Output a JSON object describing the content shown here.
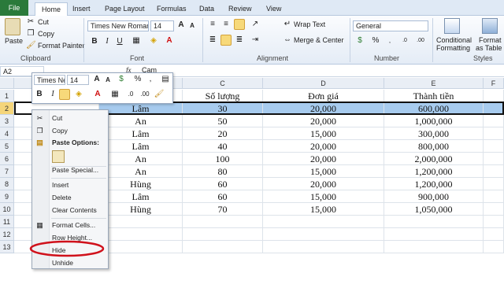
{
  "tabs": [
    "File",
    "Home",
    "Insert",
    "Page Layout",
    "Formulas",
    "Data",
    "Review",
    "View"
  ],
  "ribbon": {
    "clipboard": {
      "paste": "Paste",
      "cut": "Cut",
      "copy": "Copy",
      "format_painter": "Format Painter",
      "label": "Clipboard"
    },
    "font": {
      "name": "Times New Roman",
      "size": "14",
      "label": "Font"
    },
    "alignment": {
      "wrap": "Wrap Text",
      "merge": "Merge & Center",
      "label": "Alignment"
    },
    "number": {
      "format": "General",
      "label": "Number"
    },
    "styles": {
      "conditional_1": "Conditional",
      "conditional_2": "Formatting",
      "format_table_1": "Format",
      "format_table_2": "as Table",
      "label": "Styles"
    }
  },
  "formula_bar": {
    "name_box": "A2",
    "fx": "fx",
    "value": "Cam"
  },
  "columns": [
    "C",
    "D",
    "E",
    "F"
  ],
  "rows": [
    "1",
    "2",
    "3",
    "4",
    "5",
    "6",
    "7",
    "8",
    "9",
    "10",
    "11",
    "12",
    "13"
  ],
  "headers": {
    "c": "Số lượng",
    "d": "Đơn giá",
    "e": "Thành tiền"
  },
  "data": [
    {
      "b": "Lâm",
      "c": "30",
      "d": "20,000",
      "e": "600,000"
    },
    {
      "b": "An",
      "c": "50",
      "d": "20,000",
      "e": "1,000,000"
    },
    {
      "b": "Lâm",
      "c": "20",
      "d": "15,000",
      "e": "300,000"
    },
    {
      "b": "Lâm",
      "c": "40",
      "d": "20,000",
      "e": "800,000"
    },
    {
      "b": "An",
      "c": "100",
      "d": "20,000",
      "e": "2,000,000"
    },
    {
      "b": "An",
      "c": "80",
      "d": "15,000",
      "e": "1,200,000"
    },
    {
      "b": "Hùng",
      "c": "60",
      "d": "20,000",
      "e": "1,200,000"
    },
    {
      "b": "Lâm",
      "c": "60",
      "d": "15,000",
      "e": "900,000"
    },
    {
      "b": "Hùng",
      "c": "70",
      "d": "15,000",
      "e": "1,050,000"
    }
  ],
  "mini_toolbar": {
    "font": "Times Ne",
    "size": "14"
  },
  "context_menu": {
    "cut": "Cut",
    "copy": "Copy",
    "paste_options": "Paste Options:",
    "paste_special": "Paste Special...",
    "insert": "Insert",
    "delete": "Delete",
    "clear": "Clear Contents",
    "format_cells": "Format Cells...",
    "row_height": "Row Height...",
    "hide": "Hide",
    "unhide": "Unhide"
  },
  "colors": {
    "file_tab": "#2a7a3b",
    "selection": "#a7cbee",
    "highlight_circle": "#d0111b"
  }
}
